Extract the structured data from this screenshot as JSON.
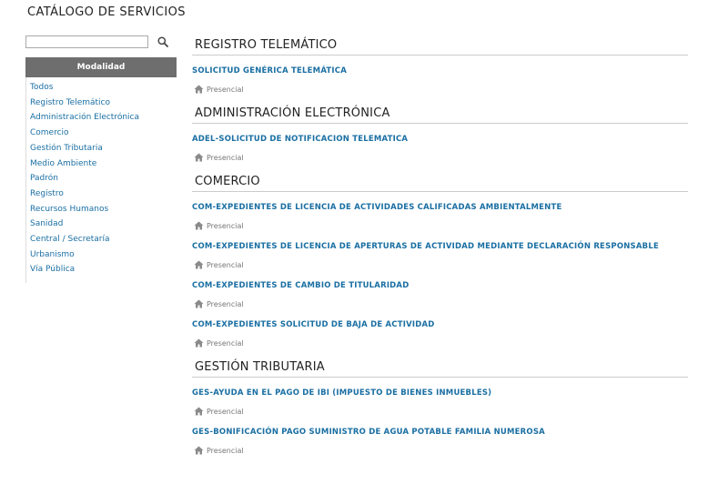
{
  "page": {
    "title": "CATÁLOGO DE SERVICIOS"
  },
  "sidebar": {
    "search": {
      "value": "",
      "placeholder": "",
      "button_icon": "search-icon"
    },
    "filter_header": "Modalidad",
    "items": [
      "Todos",
      "Registro Telemático",
      "Administración Electrónica",
      "Comercio",
      "Gestión Tributaria",
      "Medio Ambiente",
      "Padrón",
      "Registro",
      "Recursos Humanos",
      "Sanidad",
      "Central / Secretaría",
      "Urbanismo",
      "Vía Pública"
    ]
  },
  "sections": [
    {
      "title": "REGISTRO TELEMÁTICO",
      "services": [
        {
          "name": "SOLICITUD GENÉRICA TELEMÁTICA",
          "mode": "Presencial",
          "icon": "home-icon"
        }
      ]
    },
    {
      "title": "ADMINISTRACIÓN ELECTRÓNICA",
      "services": [
        {
          "name": "ADEL-SOLICITUD DE NOTIFICACION TELEMATICA",
          "mode": "Presencial",
          "icon": "home-icon"
        }
      ]
    },
    {
      "title": "COMERCIO",
      "services": [
        {
          "name": "COM-EXPEDIENTES DE LICENCIA DE ACTIVIDADES CALIFICADAS AMBIENTALMENTE",
          "mode": "Presencial",
          "icon": "home-icon"
        },
        {
          "name": "COM-EXPEDIENTES DE LICENCIA DE APERTURAS DE ACTIVIDAD MEDIANTE DECLARACIÓN RESPONSABLE",
          "mode": "Presencial",
          "icon": "home-icon"
        },
        {
          "name": "COM-EXPEDIENTES DE CAMBIO DE TITULARIDAD",
          "mode": "Presencial",
          "icon": "home-icon"
        },
        {
          "name": "COM-EXPEDIENTES SOLICITUD DE BAJA DE ACTIVIDAD",
          "mode": "Presencial",
          "icon": "home-icon"
        }
      ]
    },
    {
      "title": "GESTIÓN TRIBUTARIA",
      "services": [
        {
          "name": "GES-AYUDA EN EL PAGO DE IBI (IMPUESTO DE BIENES INMUEBLES)",
          "mode": "Presencial",
          "icon": "home-icon"
        },
        {
          "name": "GES-BONIFICACIÓN PAGO SUMINISTRO DE AGUA POTABLE FAMILIA NUMEROSA",
          "mode": "Presencial",
          "icon": "home-icon"
        }
      ]
    }
  ],
  "colors": {
    "link": "#1a6fa3",
    "filter_header_bg": "#6e6e6e",
    "muted_text": "#777777",
    "divider": "#cccccc"
  }
}
